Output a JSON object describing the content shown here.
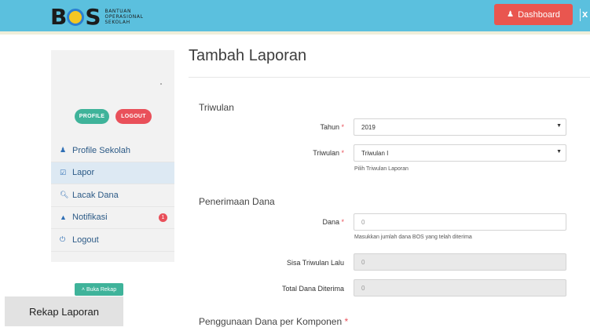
{
  "header": {
    "logo_text_left": "B",
    "logo_text_right": "S",
    "logo_tagline": [
      "BANTUAN",
      "OPERASIONAL",
      "SEKOLAH"
    ],
    "dashboard_label": "Dashboard",
    "dashboard_icon": "user-icon",
    "close_icon": "close-icon"
  },
  "sidebar": {
    "profile_label": "PROFILE",
    "logout_pill_label": "LOGOUT",
    "items": [
      {
        "label": "Profile Sekolah",
        "icon": "user-icon"
      },
      {
        "label": "Lapor",
        "icon": "checkbox-icon",
        "active": true
      },
      {
        "label": "Lacak Dana",
        "icon": "search-icon"
      },
      {
        "label": "Notifikasi",
        "icon": "bell-icon",
        "badge": "1"
      },
      {
        "label": "Logout",
        "icon": "power-icon"
      }
    ],
    "buka_rekap_label": "Buka Rekap",
    "rekap_laporan_label": "Rekap Laporan"
  },
  "main": {
    "title": "Tambah Laporan",
    "triwulan_section": "Triwulan",
    "tahun_label": "Tahun",
    "tahun_value": "2019",
    "triwulan_label": "Triwulan",
    "triwulan_value": "Triwulan I",
    "triwulan_help": "Pilih Triwulan Laporan",
    "penerimaan_section": "Penerimaan Dana",
    "dana_label": "Dana",
    "dana_placeholder": "0",
    "dana_help": "Masukkan jumlah dana BOS yang telah diterima",
    "sisa_label": "Sisa Triwulan Lalu",
    "sisa_value": "0",
    "total_label": "Total Dana Diterima",
    "total_value": "0",
    "penggunaan_section": "Penggunaan Dana per Komponen",
    "required_mark": "*"
  },
  "colors": {
    "header_bg": "#5bc0de",
    "dashboard_btn": "#e9564f",
    "accent_green": "#3fb39a",
    "accent_red": "#e9505a",
    "link_blue": "#2c5a86"
  }
}
